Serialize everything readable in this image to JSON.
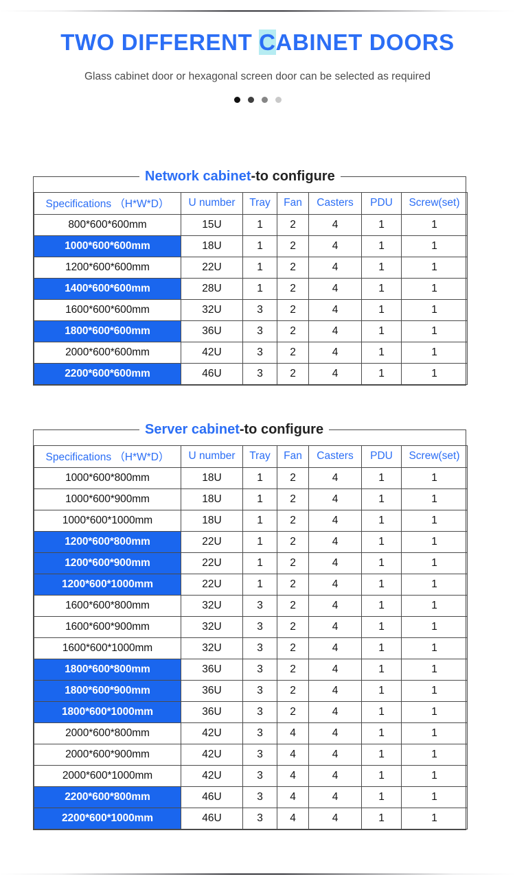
{
  "hero": {
    "title_pre": "TWO DIFFERENT ",
    "title_highlight": "C",
    "title_post": "ABINET DOORS",
    "title_full": "TWO DIFFERENT CABINET DOORS",
    "subtitle": "Glass cabinet door or hexagonal screen door can be selected as required",
    "accent_color": "#2b6ef5",
    "highlight_color": "#b6ecf2",
    "dots": [
      {
        "name": "carousel-dot-1",
        "color": "#111111",
        "active": true
      },
      {
        "name": "carousel-dot-2",
        "color": "#3f3f3f",
        "active": false
      },
      {
        "name": "carousel-dot-3",
        "color": "#868686",
        "active": false
      },
      {
        "name": "carousel-dot-4",
        "color": "#c9c9c9",
        "active": false
      }
    ]
  },
  "tables": [
    {
      "legend_kind": "Network cabinet",
      "legend_tail": "-to configure",
      "columns": [
        "Specifications （H*W*D）",
        "U number",
        "Tray",
        "Fan",
        "Casters",
        "PDU",
        "Screw(set)"
      ],
      "rows": [
        {
          "spec": "800*600*600mm",
          "u": "15U",
          "tray": "1",
          "fan": "2",
          "casters": "4",
          "pdu": "1",
          "screw": "1",
          "hi": false
        },
        {
          "spec": "1000*600*600mm",
          "u": "18U",
          "tray": "1",
          "fan": "2",
          "casters": "4",
          "pdu": "1",
          "screw": "1",
          "hi": true
        },
        {
          "spec": "1200*600*600mm",
          "u": "22U",
          "tray": "1",
          "fan": "2",
          "casters": "4",
          "pdu": "1",
          "screw": "1",
          "hi": false
        },
        {
          "spec": "1400*600*600mm",
          "u": "28U",
          "tray": "1",
          "fan": "2",
          "casters": "4",
          "pdu": "1",
          "screw": "1",
          "hi": true
        },
        {
          "spec": "1600*600*600mm",
          "u": "32U",
          "tray": "3",
          "fan": "2",
          "casters": "4",
          "pdu": "1",
          "screw": "1",
          "hi": false
        },
        {
          "spec": "1800*600*600mm",
          "u": "36U",
          "tray": "3",
          "fan": "2",
          "casters": "4",
          "pdu": "1",
          "screw": "1",
          "hi": true
        },
        {
          "spec": "2000*600*600mm",
          "u": "42U",
          "tray": "3",
          "fan": "2",
          "casters": "4",
          "pdu": "1",
          "screw": "1",
          "hi": false
        },
        {
          "spec": "2200*600*600mm",
          "u": "46U",
          "tray": "3",
          "fan": "2",
          "casters": "4",
          "pdu": "1",
          "screw": "1",
          "hi": true
        }
      ]
    },
    {
      "legend_kind": "Server cabinet",
      "legend_tail": "-to configure",
      "columns": [
        "Specifications （H*W*D）",
        "U number",
        "Tray",
        "Fan",
        "Casters",
        "PDU",
        "Screw(set)"
      ],
      "rows": [
        {
          "spec": "1000*600*800mm",
          "u": "18U",
          "tray": "1",
          "fan": "2",
          "casters": "4",
          "pdu": "1",
          "screw": "1",
          "hi": false
        },
        {
          "spec": "1000*600*900mm",
          "u": "18U",
          "tray": "1",
          "fan": "2",
          "casters": "4",
          "pdu": "1",
          "screw": "1",
          "hi": false
        },
        {
          "spec": "1000*600*1000mm",
          "u": "18U",
          "tray": "1",
          "fan": "2",
          "casters": "4",
          "pdu": "1",
          "screw": "1",
          "hi": false
        },
        {
          "spec": "1200*600*800mm",
          "u": "22U",
          "tray": "1",
          "fan": "2",
          "casters": "4",
          "pdu": "1",
          "screw": "1",
          "hi": true
        },
        {
          "spec": "1200*600*900mm",
          "u": "22U",
          "tray": "1",
          "fan": "2",
          "casters": "4",
          "pdu": "1",
          "screw": "1",
          "hi": true
        },
        {
          "spec": "1200*600*1000mm",
          "u": "22U",
          "tray": "1",
          "fan": "2",
          "casters": "4",
          "pdu": "1",
          "screw": "1",
          "hi": true
        },
        {
          "spec": "1600*600*800mm",
          "u": "32U",
          "tray": "3",
          "fan": "2",
          "casters": "4",
          "pdu": "1",
          "screw": "1",
          "hi": false
        },
        {
          "spec": "1600*600*900mm",
          "u": "32U",
          "tray": "3",
          "fan": "2",
          "casters": "4",
          "pdu": "1",
          "screw": "1",
          "hi": false
        },
        {
          "spec": "1600*600*1000mm",
          "u": "32U",
          "tray": "3",
          "fan": "2",
          "casters": "4",
          "pdu": "1",
          "screw": "1",
          "hi": false
        },
        {
          "spec": "1800*600*800mm",
          "u": "36U",
          "tray": "3",
          "fan": "2",
          "casters": "4",
          "pdu": "1",
          "screw": "1",
          "hi": true
        },
        {
          "spec": "1800*600*900mm",
          "u": "36U",
          "tray": "3",
          "fan": "2",
          "casters": "4",
          "pdu": "1",
          "screw": "1",
          "hi": true
        },
        {
          "spec": "1800*600*1000mm",
          "u": "36U",
          "tray": "3",
          "fan": "2",
          "casters": "4",
          "pdu": "1",
          "screw": "1",
          "hi": true
        },
        {
          "spec": "2000*600*800mm",
          "u": "42U",
          "tray": "3",
          "fan": "4",
          "casters": "4",
          "pdu": "1",
          "screw": "1",
          "hi": false
        },
        {
          "spec": "2000*600*900mm",
          "u": "42U",
          "tray": "3",
          "fan": "4",
          "casters": "4",
          "pdu": "1",
          "screw": "1",
          "hi": false
        },
        {
          "spec": "2000*600*1000mm",
          "u": "42U",
          "tray": "3",
          "fan": "4",
          "casters": "4",
          "pdu": "1",
          "screw": "1",
          "hi": false
        },
        {
          "spec": "2200*600*800mm",
          "u": "46U",
          "tray": "3",
          "fan": "4",
          "casters": "4",
          "pdu": "1",
          "screw": "1",
          "hi": true
        },
        {
          "spec": "2200*600*1000mm",
          "u": "46U",
          "tray": "3",
          "fan": "4",
          "casters": "4",
          "pdu": "1",
          "screw": "1",
          "hi": true
        }
      ]
    }
  ]
}
